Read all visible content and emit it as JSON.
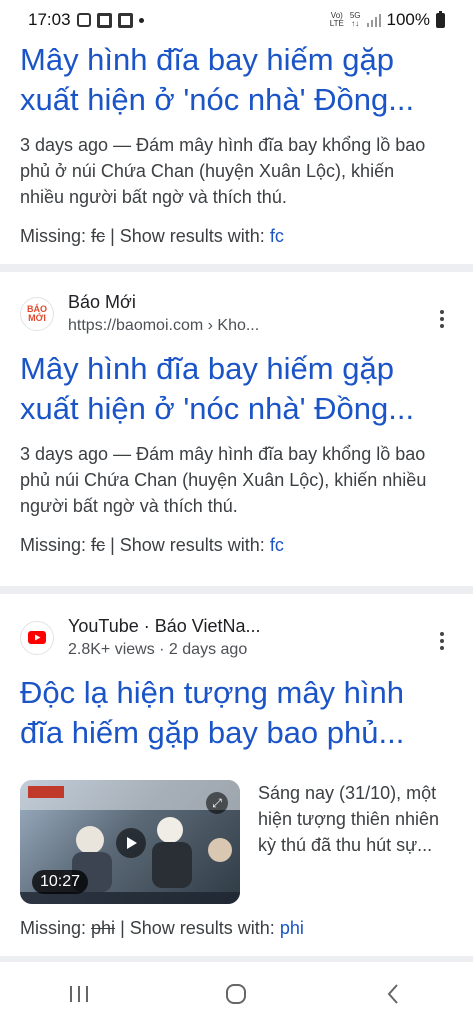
{
  "status_bar": {
    "time": "17:03",
    "battery": "100%",
    "lte_top": "Vo)",
    "lte_bottom": "LTE",
    "net_top": "5G",
    "net_bottom": "↑↓"
  },
  "results": [
    {
      "title_line1": "Mây hình đĩa bay hiếm gặp",
      "title_line2": "xuất hiện ở 'nóc nhà' Đồng...",
      "snippet_line1": "3 days ago — Đám mây hình đĩa bay khổng lồ bao",
      "snippet_line2": "phủ ở núi Chứa Chan (huyện Xuân Lộc), khiến",
      "snippet_line3": "nhiều người bất ngờ và thích thú.",
      "missing_label": "Missing:",
      "missing_term": "fc",
      "show_label": "| Show results with:",
      "show_term": "fc"
    },
    {
      "site_name": "Báo Mới",
      "favicon_text_1": "BÁO",
      "favicon_text_2": "MỚI",
      "url": "https://baomoi.com › Kho...",
      "title_line1": "Mây hình đĩa bay hiếm gặp",
      "title_line2": "xuất hiện ở 'nóc nhà' Đồng...",
      "snippet_line1": "3 days ago — Đám mây hình đĩa bay khổng lồ bao",
      "snippet_line2": "phủ núi Chứa Chan (huyện Xuân Lộc), khiến nhiều",
      "snippet_line3": "người bất ngờ và thích thú.",
      "missing_label": "Missing:",
      "missing_term": "fc",
      "show_label": "| Show results with:",
      "show_term": "fc"
    },
    {
      "site_name": "YouTube · Báo VietNa...",
      "meta": "2.8K+ views · 2 days ago",
      "title_line1": "Độc lạ hiện tượng mây hình",
      "title_line2": "đĩa hiếm gặp bay bao phủ...",
      "video_duration": "10:27",
      "desc_line1": "Sáng nay (31/10), một",
      "desc_line2": "hiện tượng thiên nhiên",
      "desc_line3": "kỳ thú đã thu hút sự...",
      "missing_label": "Missing:",
      "missing_term": "phi",
      "show_label": "| Show results with:",
      "show_term": "phi"
    }
  ],
  "colors": {
    "link": "#1a54c7",
    "separator": "#eceef1",
    "youtube": "#ff0000"
  }
}
